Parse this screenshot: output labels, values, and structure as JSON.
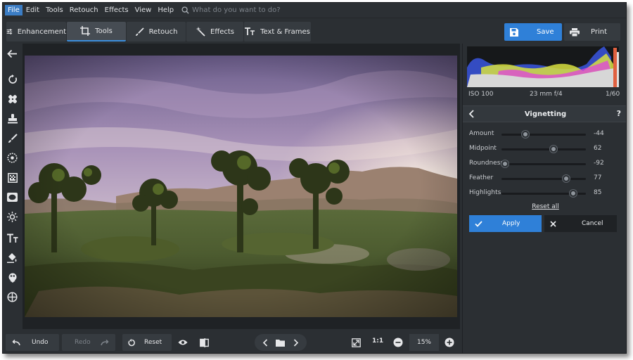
{
  "menu": {
    "items": [
      "File",
      "Edit",
      "Tools",
      "Retouch",
      "Effects",
      "View",
      "Help"
    ],
    "search_placeholder": "What do you want to do?"
  },
  "tabs": [
    {
      "label": "Enhancement",
      "icon": "sliders-icon"
    },
    {
      "label": "Tools",
      "icon": "crop-icon",
      "active": true
    },
    {
      "label": "Retouch",
      "icon": "brush-icon"
    },
    {
      "label": "Effects",
      "icon": "magic-wand-icon"
    },
    {
      "label": "Text & Frames",
      "icon": "text-icon"
    }
  ],
  "actions": {
    "save_label": "Save",
    "print_label": "Print"
  },
  "left_tools": [
    "back-arrow-icon",
    "rotate-icon",
    "healing-patch-icon",
    "stamp-icon",
    "brush-icon",
    "radial-target-icon",
    "gradient-filter-icon",
    "vignette-icon",
    "sun-icon",
    "text-icon",
    "paint-bucket-icon",
    "color-picker-icon",
    "crosshair-icon"
  ],
  "exif": {
    "iso": "ISO 100",
    "lens": "23 mm f/4",
    "shutter": "1/60"
  },
  "panel": {
    "title": "Vignetting",
    "help": "?",
    "sliders": [
      {
        "label": "Amount",
        "value": "-44",
        "min": -100,
        "max": 100,
        "level": -44
      },
      {
        "label": "Midpoint",
        "value": "62",
        "min": 0,
        "max": 100,
        "level": 62
      },
      {
        "label": "Roundness",
        "value": "-92",
        "min": -100,
        "max": 100,
        "level": -92
      },
      {
        "label": "Feather",
        "value": "77",
        "min": 0,
        "max": 100,
        "level": 77
      },
      {
        "label": "Highlights",
        "value": "85",
        "min": 0,
        "max": 100,
        "level": 85
      }
    ],
    "reset_all": "Reset all",
    "apply_label": "Apply",
    "cancel_label": "Cancel"
  },
  "bottom": {
    "undo_label": "Undo",
    "redo_label": "Redo",
    "reset_label": "Reset",
    "one_to_one": "1:1",
    "zoom": "15%"
  },
  "colors": {
    "accent": "#2f80d8",
    "panel": "#2b2f33",
    "canvas": "#1f2225"
  }
}
